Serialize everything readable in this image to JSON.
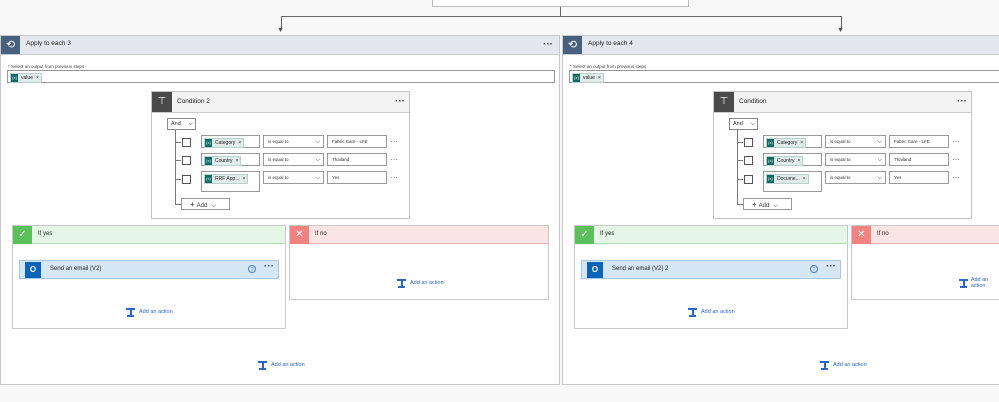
{
  "loops": [
    {
      "title": "Apply to each 3",
      "output_label": "Select an output from previous steps",
      "required_mark": "*",
      "token": "value",
      "condition": {
        "title": "Condition 2",
        "group_op": "And",
        "rows": [
          {
            "lhs": "Category",
            "op": "is equal to",
            "rhs": "Fabric Care - LFE"
          },
          {
            "lhs": "Country",
            "op": "is equal to",
            "rhs": "Thailand"
          },
          {
            "lhs": "RRF App...",
            "op": "is equal to",
            "rhs": "Yes"
          }
        ],
        "add_label": "Add"
      },
      "if_yes": {
        "title": "If yes",
        "action": "Send an email (V2)",
        "add_action": "Add an action"
      },
      "if_no": {
        "title": "If no",
        "add_action": "Add an action"
      },
      "add_action": "Add an action"
    },
    {
      "title": "Apply to each 4",
      "output_label": "Select an output from previous steps",
      "required_mark": "*",
      "token": "value",
      "condition": {
        "title": "Condition",
        "group_op": "And",
        "rows": [
          {
            "lhs": "Category",
            "op": "is equal to",
            "rhs": "Fabric Care - LFE"
          },
          {
            "lhs": "Country",
            "op": "is equal to",
            "rhs": "Thailand"
          },
          {
            "lhs": "Docume...",
            "op": "is equal to",
            "rhs": "Yes"
          }
        ],
        "add_label": "Add"
      },
      "if_yes": {
        "title": "If yes",
        "action": "Send an email (V2) 2",
        "add_action": "Add an action"
      },
      "if_no": {
        "title": "If no",
        "add_action": "Add an action"
      },
      "add_action": "Add an action"
    }
  ],
  "icons": {
    "loop": "loop-icon",
    "condition": "condition-icon",
    "yes": "check-icon",
    "no": "close-icon",
    "email": "outlook-icon",
    "token": "dynamic-content-icon",
    "add_action": "add-action-icon"
  },
  "colors": {
    "loop_header": "#47607e",
    "yes_accent": "#5bbf5b",
    "no_accent": "#f0837f",
    "email_accent": "#0a64b8",
    "link": "#2b66c8",
    "token_bg": "#0f6b63"
  },
  "ui": {
    "dots": "···",
    "x": "×",
    "chev": "⌵",
    "plus": "+",
    "help": "?"
  }
}
